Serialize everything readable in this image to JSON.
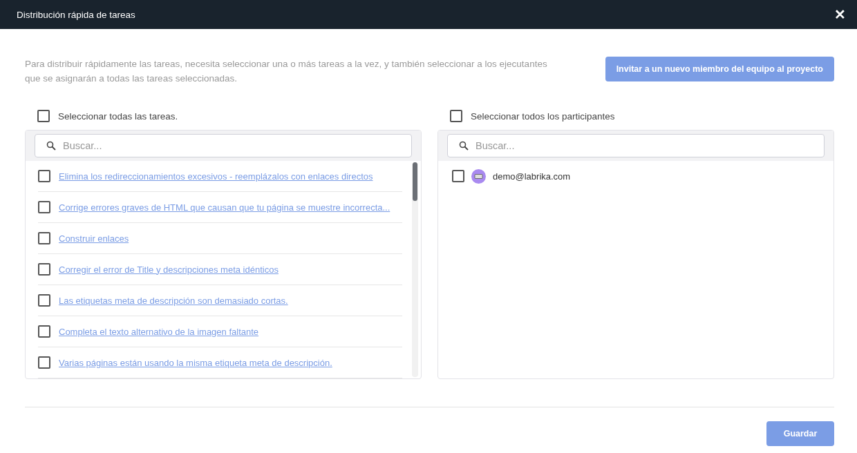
{
  "window": {
    "title": "Distribución rápida de tareas",
    "close": "✕"
  },
  "description": "Para distribuir rápidamente las tareas, necesita seleccionar una o más tareas a la vez, y también seleccionar a los ejecutantes que se asignarán a todas las tareas seleccionadas.",
  "invite_button": "Invitar a un nuevo miembro del equipo al proyecto",
  "tasks": {
    "select_all": {
      "label": "Seleccionar todas las tareas.",
      "checked": false
    },
    "search": {
      "placeholder": "Buscar..."
    },
    "items": [
      {
        "label": "Elimina los redireccionamientos excesivos - reemplázalos con enlaces directos",
        "checked": false
      },
      {
        "label": "Corrige errores graves de HTML que causan que tu página se muestre incorrecta...",
        "checked": false
      },
      {
        "label": "Construir enlaces",
        "checked": false
      },
      {
        "label": "Corregir el error de Title y descripciones meta idénticos",
        "checked": false
      },
      {
        "label": "Las etiquetas meta de descripción son demasiado cortas.",
        "checked": false
      },
      {
        "label": "Completa el texto alternativo de la imagen faltante",
        "checked": false
      },
      {
        "label": "Varias páginas están usando la misma etiqueta meta de descripción.",
        "checked": false
      }
    ]
  },
  "participants": {
    "select_all": {
      "label": "Seleccionar todos los participantes",
      "checked": false
    },
    "search": {
      "placeholder": "Buscar..."
    },
    "items": [
      {
        "email": "demo@labrika.com",
        "checked": false
      }
    ]
  },
  "save_button": "Guardar"
}
